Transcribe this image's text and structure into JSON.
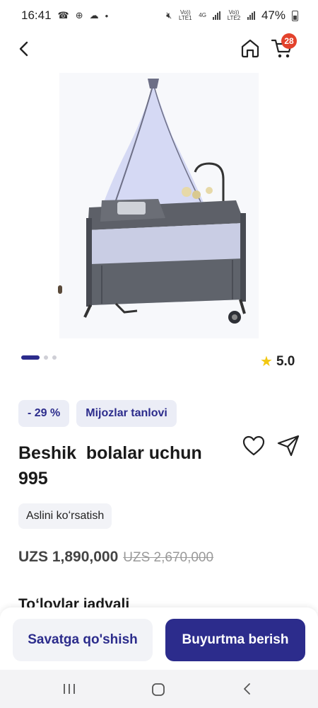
{
  "status_bar": {
    "time": "16:41",
    "signal1_label": "Vo)) LTE1",
    "signal2_label": "Vo)) LTE2",
    "network": "4G",
    "battery": "47%"
  },
  "header": {
    "cart_count": "28"
  },
  "gallery": {
    "pages": 3,
    "current_page": 1
  },
  "rating": {
    "value": "5.0"
  },
  "badges": {
    "discount": "- 29 %",
    "choice": "Mijozlar tanlovi"
  },
  "product": {
    "title": "Beshik  bolalar uchun\n995",
    "original_label": "Aslini koʻrsatish",
    "price": "UZS 1,890,000",
    "old_price": "UZS 2,670,000"
  },
  "sections": {
    "payments_title": "Toʻlovlar jadvali"
  },
  "actions": {
    "add_to_cart": "Savatga qo'shish",
    "order": "Buyurtma berish"
  },
  "colors": {
    "brand": "#2c2c8c",
    "badge_bg": "#ebedf6",
    "cart_badge": "#e3422c",
    "star": "#f2c811"
  }
}
